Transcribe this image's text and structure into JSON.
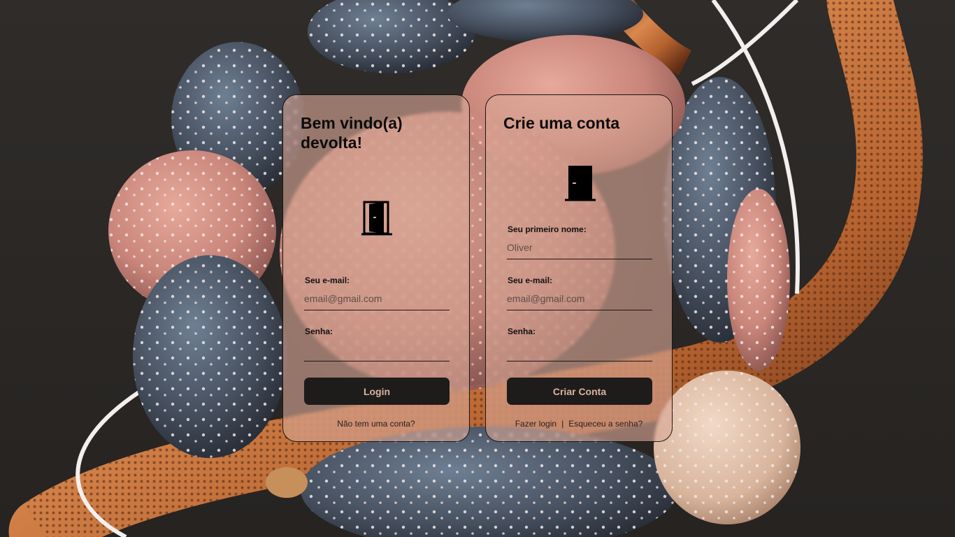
{
  "login": {
    "title": "Bem vindo(a) devolta!",
    "icon": "door-open-icon",
    "email_label": "Seu e-mail:",
    "email_placeholder": "email@gmail.com",
    "password_label": "Senha:",
    "password_placeholder": "",
    "button_label": "Login",
    "no_account_link": "Não tem uma conta?"
  },
  "signup": {
    "title": "Crie uma conta",
    "icon": "door-closed-icon",
    "first_name_label": "Seu primeiro nome:",
    "first_name_placeholder": "Oliver",
    "email_label": "Seu e-mail:",
    "email_placeholder": "email@gmail.com",
    "password_label": "Senha:",
    "password_placeholder": "",
    "button_label": "Criar Conta",
    "login_link": "Fazer login",
    "separator": "|",
    "forgot_link": "Esqueceu a senha?"
  },
  "colors": {
    "card_bg": "#daa896",
    "button_bg": "#1e1b1b",
    "button_text": "#d9b59c",
    "page_bg": "#2b2826"
  }
}
